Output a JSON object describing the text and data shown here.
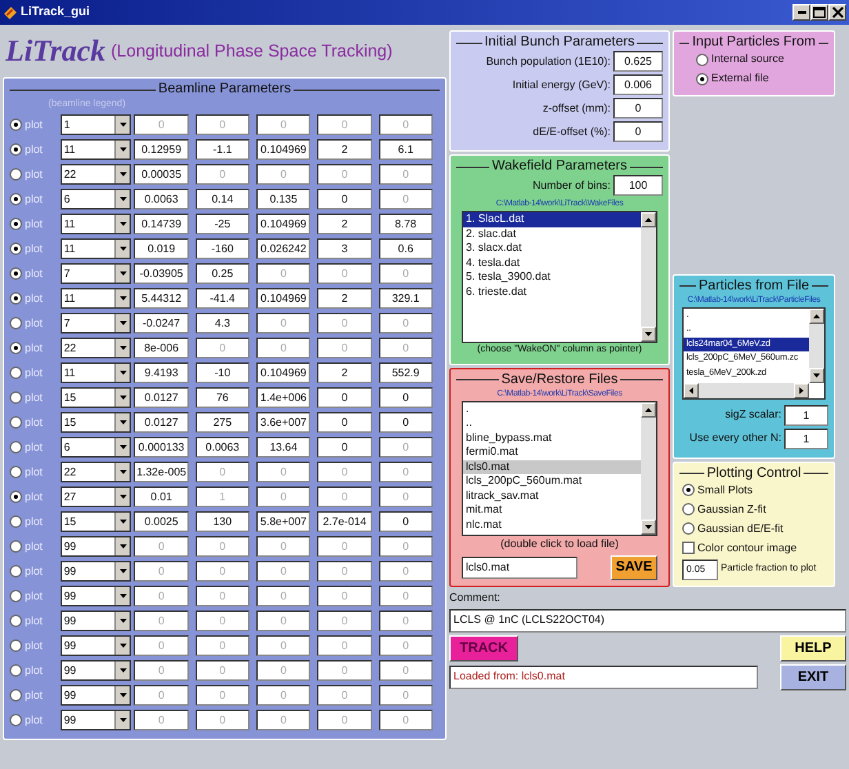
{
  "window": {
    "title": "LiTrack_gui"
  },
  "header": {
    "logo": "LiTrack",
    "subtitle": "(Longitudinal Phase Space Tracking)"
  },
  "beamline": {
    "title": "Beamline Parameters",
    "legend": "(beamline legend)",
    "rows": [
      {
        "selected": true,
        "label": "plot",
        "code": "1",
        "cells": [
          "0",
          "0",
          "0",
          "0",
          "0"
        ],
        "dim": [
          true,
          true,
          true,
          true,
          true
        ]
      },
      {
        "selected": true,
        "label": "plot",
        "code": "11",
        "cells": [
          "0.12959",
          "-1.1",
          "0.104969",
          "2",
          "6.1"
        ],
        "dim": [
          false,
          false,
          false,
          false,
          false
        ]
      },
      {
        "selected": false,
        "label": "plot",
        "code": "22",
        "cells": [
          "0.00035",
          "0",
          "0",
          "0",
          "0"
        ],
        "dim": [
          false,
          true,
          true,
          true,
          true
        ]
      },
      {
        "selected": true,
        "label": "plot",
        "code": "6",
        "cells": [
          "0.0063",
          "0.14",
          "0.135",
          "0",
          "0"
        ],
        "dim": [
          false,
          false,
          false,
          false,
          true
        ]
      },
      {
        "selected": true,
        "label": "plot",
        "code": "11",
        "cells": [
          "0.14739",
          "-25",
          "0.104969",
          "2",
          "8.78"
        ],
        "dim": [
          false,
          false,
          false,
          false,
          false
        ]
      },
      {
        "selected": true,
        "label": "plot",
        "code": "11",
        "cells": [
          "0.019",
          "-160",
          "0.026242",
          "3",
          "0.6"
        ],
        "dim": [
          false,
          false,
          false,
          false,
          false
        ]
      },
      {
        "selected": true,
        "label": "plot",
        "code": "7",
        "cells": [
          "-0.03905",
          "0.25",
          "0",
          "0",
          "0"
        ],
        "dim": [
          false,
          false,
          true,
          true,
          true
        ]
      },
      {
        "selected": true,
        "label": "plot",
        "code": "11",
        "cells": [
          "5.44312",
          "-41.4",
          "0.104969",
          "2",
          "329.1"
        ],
        "dim": [
          false,
          false,
          false,
          false,
          false
        ]
      },
      {
        "selected": false,
        "label": "plot",
        "code": "7",
        "cells": [
          "-0.0247",
          "4.3",
          "0",
          "0",
          "0"
        ],
        "dim": [
          false,
          false,
          true,
          true,
          true
        ]
      },
      {
        "selected": true,
        "label": "plot",
        "code": "22",
        "cells": [
          "8e-006",
          "0",
          "0",
          "0",
          "0"
        ],
        "dim": [
          false,
          true,
          true,
          true,
          true
        ]
      },
      {
        "selected": false,
        "label": "plot",
        "code": "11",
        "cells": [
          "9.4193",
          "-10",
          "0.104969",
          "2",
          "552.9"
        ],
        "dim": [
          false,
          false,
          false,
          false,
          false
        ]
      },
      {
        "selected": false,
        "label": "plot",
        "code": "15",
        "cells": [
          "0.0127",
          "76",
          "1.4e+006",
          "0",
          "0"
        ],
        "dim": [
          false,
          false,
          false,
          false,
          false
        ]
      },
      {
        "selected": false,
        "label": "plot",
        "code": "15",
        "cells": [
          "0.0127",
          "275",
          "3.6e+007",
          "0",
          "0"
        ],
        "dim": [
          false,
          false,
          false,
          false,
          false
        ]
      },
      {
        "selected": false,
        "label": "plot",
        "code": "6",
        "cells": [
          "0.000133",
          "0.0063",
          "13.64",
          "0",
          "0"
        ],
        "dim": [
          false,
          false,
          false,
          false,
          true
        ]
      },
      {
        "selected": false,
        "label": "plot",
        "code": "22",
        "cells": [
          "1.32e-005",
          "0",
          "0",
          "0",
          "0"
        ],
        "dim": [
          false,
          true,
          true,
          true,
          true
        ]
      },
      {
        "selected": true,
        "label": "plot",
        "code": "27",
        "cells": [
          "0.01",
          "1",
          "0",
          "0",
          "0"
        ],
        "dim": [
          false,
          true,
          true,
          true,
          true
        ]
      },
      {
        "selected": false,
        "label": "plot",
        "code": "15",
        "cells": [
          "0.0025",
          "130",
          "5.8e+007",
          "2.7e-014",
          "0"
        ],
        "dim": [
          false,
          false,
          false,
          false,
          false
        ]
      },
      {
        "selected": false,
        "label": "plot",
        "code": "99",
        "cells": [
          "0",
          "0",
          "0",
          "0",
          "0"
        ],
        "dim": [
          true,
          true,
          true,
          true,
          true
        ]
      },
      {
        "selected": false,
        "label": "plot",
        "code": "99",
        "cells": [
          "0",
          "0",
          "0",
          "0",
          "0"
        ],
        "dim": [
          true,
          true,
          true,
          true,
          true
        ]
      },
      {
        "selected": false,
        "label": "plot",
        "code": "99",
        "cells": [
          "0",
          "0",
          "0",
          "0",
          "0"
        ],
        "dim": [
          true,
          true,
          true,
          true,
          true
        ]
      },
      {
        "selected": false,
        "label": "plot",
        "code": "99",
        "cells": [
          "0",
          "0",
          "0",
          "0",
          "0"
        ],
        "dim": [
          true,
          true,
          true,
          true,
          true
        ]
      },
      {
        "selected": false,
        "label": "plot",
        "code": "99",
        "cells": [
          "0",
          "0",
          "0",
          "0",
          "0"
        ],
        "dim": [
          true,
          true,
          true,
          true,
          true
        ]
      },
      {
        "selected": false,
        "label": "plot",
        "code": "99",
        "cells": [
          "0",
          "0",
          "0",
          "0",
          "0"
        ],
        "dim": [
          true,
          true,
          true,
          true,
          true
        ]
      },
      {
        "selected": false,
        "label": "plot",
        "code": "99",
        "cells": [
          "0",
          "0",
          "0",
          "0",
          "0"
        ],
        "dim": [
          true,
          true,
          true,
          true,
          true
        ]
      },
      {
        "selected": false,
        "label": "plot",
        "code": "99",
        "cells": [
          "0",
          "0",
          "0",
          "0",
          "0"
        ],
        "dim": [
          true,
          true,
          true,
          true,
          true
        ]
      }
    ]
  },
  "bunch": {
    "title": "Initial Bunch Parameters",
    "fields": [
      {
        "label": "Bunch population (1E10):",
        "value": "0.625"
      },
      {
        "label": "Initial energy (GeV):",
        "value": "0.006"
      },
      {
        "label": "z-offset (mm):",
        "value": "0"
      },
      {
        "label": "dE/E-offset (%):",
        "value": "0"
      }
    ]
  },
  "wakefield": {
    "title": "Wakefield Parameters",
    "bins": {
      "label": "Number of bins:",
      "value": "100"
    },
    "path": "C:\\Matlab-14\\work\\LiTrack\\WakeFiles",
    "files": [
      {
        "text": "1. SlacL.dat",
        "selected": true
      },
      {
        "text": "2. slac.dat",
        "selected": false
      },
      {
        "text": "3. slacx.dat",
        "selected": false
      },
      {
        "text": "4. tesla.dat",
        "selected": false
      },
      {
        "text": "5. tesla_3900.dat",
        "selected": false
      },
      {
        "text": "6. trieste.dat",
        "selected": false
      }
    ],
    "note": "(choose \"WakeON\" column as pointer)"
  },
  "save_restore": {
    "title": "Save/Restore Files",
    "path": "C:\\Matlab-14\\work\\LiTrack\\SaveFiles",
    "files": [
      {
        "text": ".",
        "selected": false
      },
      {
        "text": "..",
        "selected": false
      },
      {
        "text": "bline_bypass.mat",
        "selected": false
      },
      {
        "text": "fermi0.mat",
        "selected": false
      },
      {
        "text": "lcls0.mat",
        "selected": true
      },
      {
        "text": "lcls_200pC_560um.mat",
        "selected": false
      },
      {
        "text": "litrack_sav.mat",
        "selected": false
      },
      {
        "text": "mit.mat",
        "selected": false
      },
      {
        "text": "nlc.mat",
        "selected": false
      }
    ],
    "note": "(double click to load file)",
    "filename": "lcls0.mat",
    "save_button": "SAVE"
  },
  "input_particles": {
    "title": "Input Particles From",
    "options": [
      {
        "label": "Internal source",
        "selected": false
      },
      {
        "label": "External file",
        "selected": true
      }
    ]
  },
  "particles_file": {
    "title": "Particles from File",
    "path": "C:\\Matlab-14\\work\\LiTrack\\ParticleFiles",
    "files": [
      {
        "text": ".",
        "selected": false
      },
      {
        "text": "..",
        "selected": false
      },
      {
        "text": "lcls24mar04_6MeV.zd",
        "selected": true
      },
      {
        "text": "lcls_200pC_6MeV_560um.zc",
        "selected": false
      },
      {
        "text": "tesla_6MeV_200k.zd",
        "selected": false
      }
    ],
    "fields": [
      {
        "label": "sigZ scalar:",
        "value": "1"
      },
      {
        "label": "Use every other N:",
        "value": "1"
      }
    ]
  },
  "plotting": {
    "title": "Plotting Control",
    "options": [
      {
        "kind": "radio",
        "label": "Small Plots",
        "selected": true
      },
      {
        "kind": "radio",
        "label": "Gaussian Z-fit",
        "selected": false
      },
      {
        "kind": "radio",
        "label": "Gaussian dE/E-fit",
        "selected": false
      },
      {
        "kind": "checkbox",
        "label": "Color contour image",
        "checked": false
      }
    ],
    "fraction": {
      "value": "0.05",
      "label": "Particle fraction to plot"
    }
  },
  "comment": {
    "label": "Comment:",
    "value": "LCLS @ 1nC (LCLS22OCT04)"
  },
  "buttons": {
    "track": "TRACK",
    "help": "HELP",
    "exit": "EXIT"
  },
  "status": "Loaded from: lcls0.mat"
}
